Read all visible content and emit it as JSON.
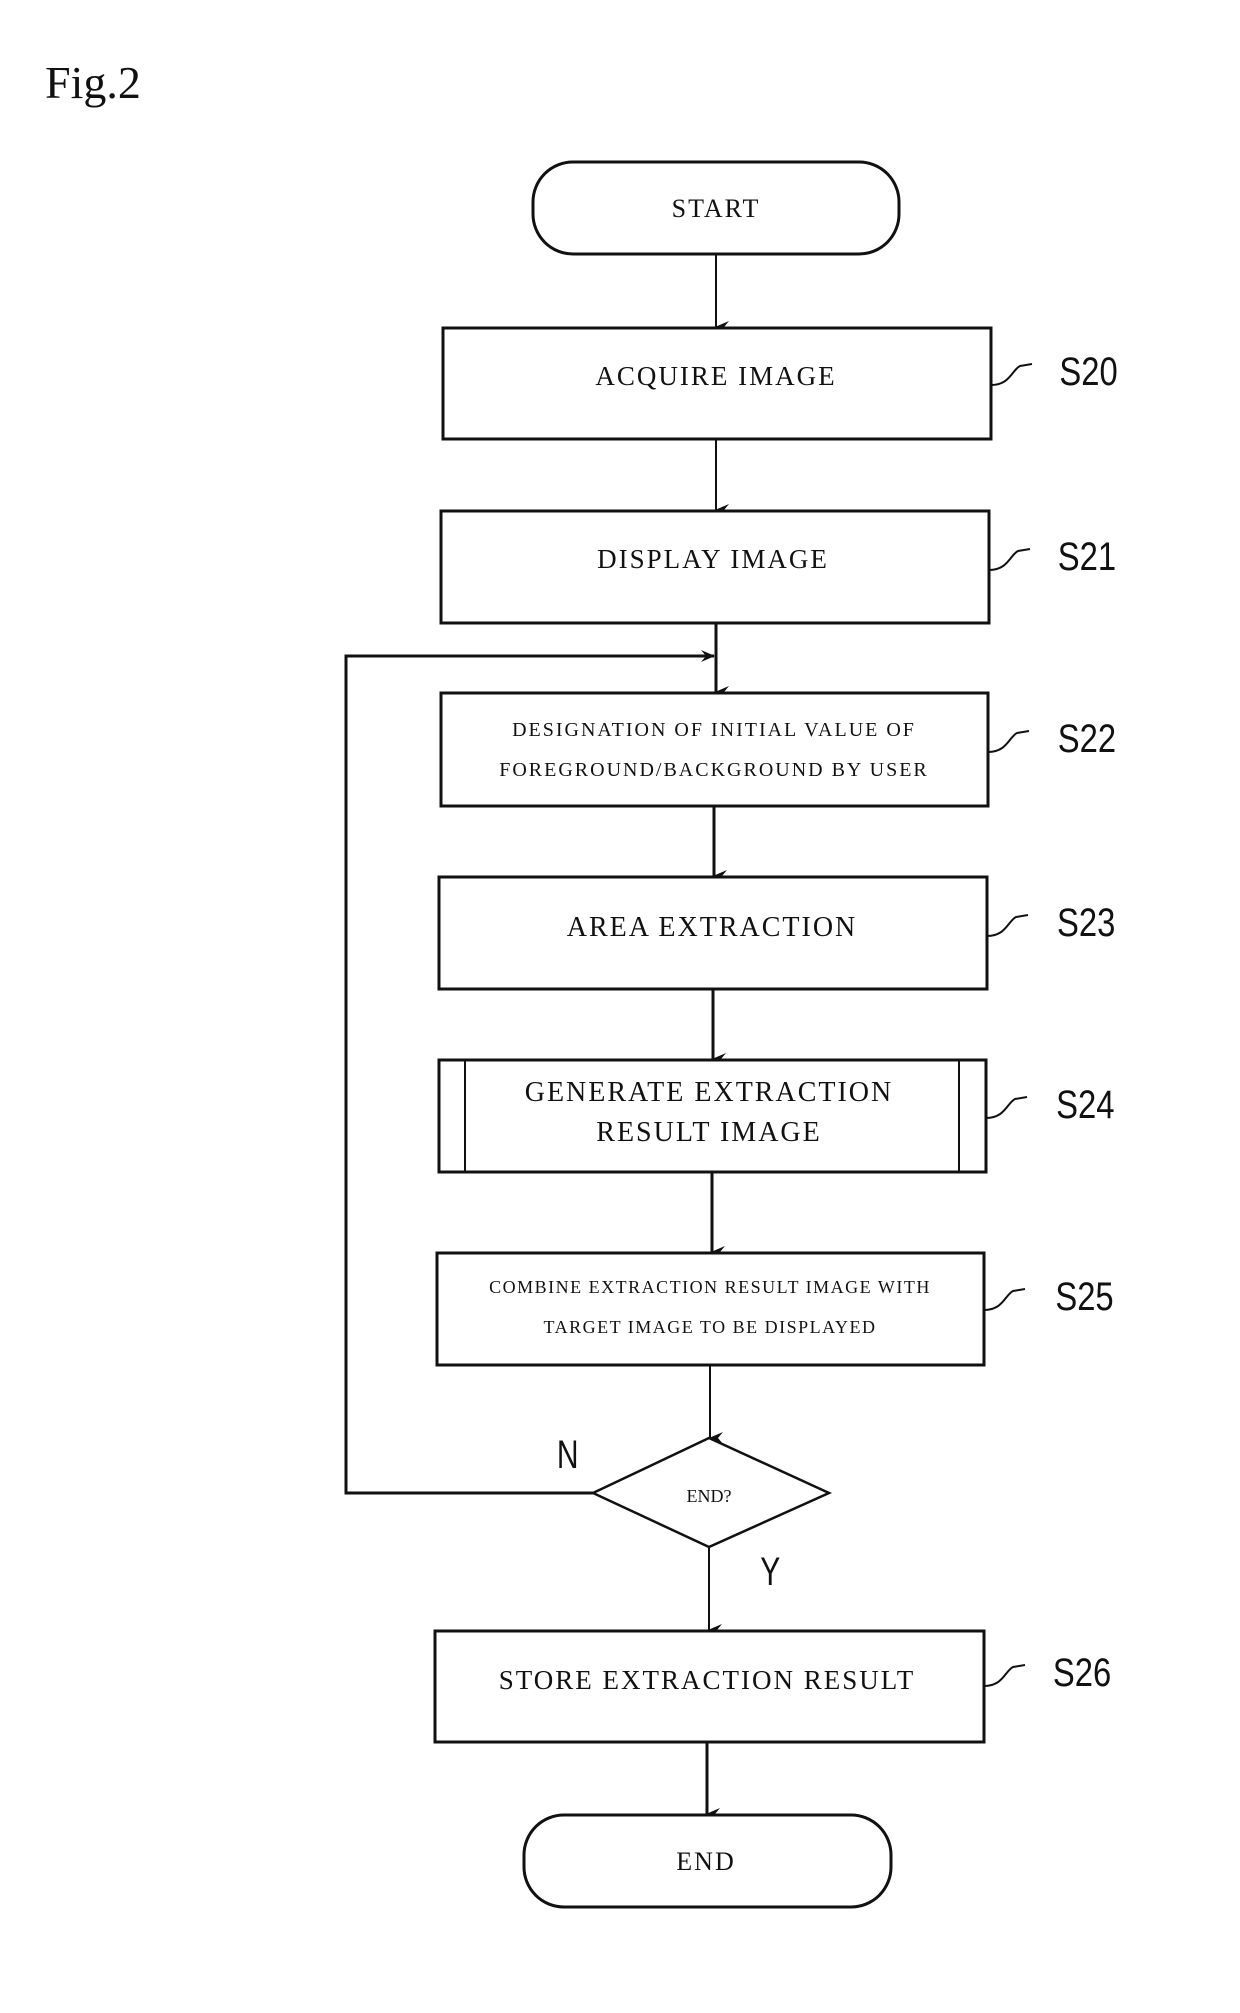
{
  "figure": {
    "title": "Fig.2"
  },
  "flowchart": {
    "start": {
      "label": "START"
    },
    "end": {
      "label": "END"
    },
    "steps": [
      {
        "id": "S20",
        "lines": [
          "ACQUIRE IMAGE"
        ]
      },
      {
        "id": "S21",
        "lines": [
          "DISPLAY IMAGE"
        ]
      },
      {
        "id": "S22",
        "lines": [
          "DESIGNATION OF INITIAL VALUE OF",
          "FOREGROUND/BACKGROUND BY USER"
        ]
      },
      {
        "id": "S23",
        "lines": [
          "AREA EXTRACTION"
        ]
      },
      {
        "id": "S24",
        "lines": [
          "GENERATE EXTRACTION",
          "RESULT IMAGE"
        ],
        "subroutine": true
      },
      {
        "id": "S25",
        "lines": [
          "COMBINE EXTRACTION RESULT IMAGE WITH",
          "TARGET IMAGE TO BE DISPLAYED"
        ]
      },
      {
        "id": "S26",
        "lines": [
          "STORE EXTRACTION RESULT"
        ]
      }
    ],
    "decision": {
      "label": "END?",
      "no_label": "N",
      "yes_label": "Y"
    }
  }
}
